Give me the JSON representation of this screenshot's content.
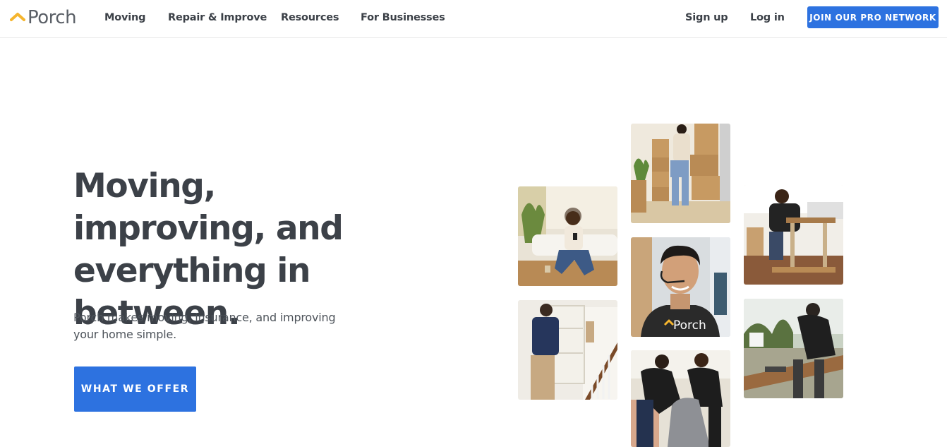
{
  "header": {
    "logo_text": "Porch",
    "nav": {
      "moving": "Moving",
      "repair": "Repair & Improve",
      "resources": "Resources",
      "business": "For Businesses"
    },
    "signup": "Sign up",
    "login": "Log in",
    "join_button": "JOIN OUR PRO NETWORK"
  },
  "hero": {
    "headline": "Moving, improving, and everything in between.",
    "subtext": "Porch makes moving, insurance, and improving your home simple.",
    "cta": "WHAT WE OFFER"
  },
  "photos": {
    "shirt_logo": "Porch"
  },
  "colors": {
    "accent": "#2d72e0",
    "logo_mark": "#f5b52e",
    "text": "#3c4148"
  }
}
